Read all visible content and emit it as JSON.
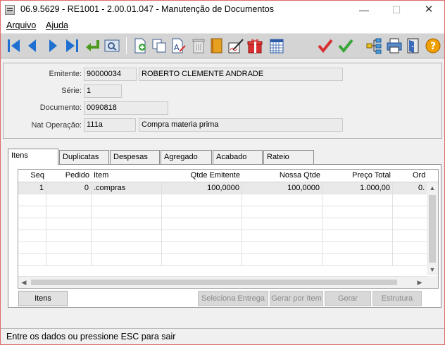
{
  "window": {
    "title": "06.9.5629 - RE1001 - 2.00.01.047 - Manutenção de Documentos",
    "minimize": "—",
    "maximize": "☐",
    "close": "✕"
  },
  "menu": {
    "arquivo": "Arquivo",
    "ajuda": "Ajuda"
  },
  "toolbar_icons": [
    "first-record-icon",
    "previous-record-icon",
    "next-record-icon",
    "last-record-icon",
    "go-to-icon",
    "search-icon",
    "add-icon",
    "copy-icon",
    "edit-icon",
    "delete-icon",
    "book-icon",
    "signature-icon",
    "gift-icon",
    "calendar-icon",
    "confirm-icon",
    "check-icon",
    "tree-icon",
    "print-icon",
    "exit-icon",
    "help-icon"
  ],
  "header": {
    "emitente_label": "Emitente:",
    "emitente_code": "90000034",
    "emitente_name": "ROBERTO CLEMENTE ANDRADE",
    "serie_label": "Série:",
    "serie_value": "1",
    "documento_label": "Documento:",
    "documento_value": "0090818",
    "nat_label": "Nat Operação:",
    "nat_code": "111a",
    "nat_desc": "Compra materia prima"
  },
  "tabs": [
    "Itens",
    "Duplicatas",
    "Despesas",
    "Agregado",
    "Acabado",
    "Rateio"
  ],
  "grid": {
    "columns": [
      "Seq",
      "Pedido",
      "Item",
      "Qtde Emitente",
      "Nossa Qtde",
      "Preço Total",
      "Ord"
    ],
    "rows": [
      [
        "1",
        "0",
        ".compras",
        "100,0000",
        "100,0000",
        "1.000,00",
        "0."
      ]
    ]
  },
  "buttons": {
    "itens": "Itens",
    "seleciona_entrega": "Seleciona Entrega",
    "gerar_por_item": "Gerar por Item",
    "gerar": "Gerar",
    "estrutura": "Estrutura"
  },
  "status": "Entre os dados ou pressione ESC para sair",
  "colors": {
    "window_border": "#e06a6a",
    "toolbar_bg": "#d4d4d4",
    "nav_blue": "#1f6fd1",
    "confirm_red": "#d83030",
    "check_green": "#3aa63a",
    "help_orange": "#f0a000"
  }
}
